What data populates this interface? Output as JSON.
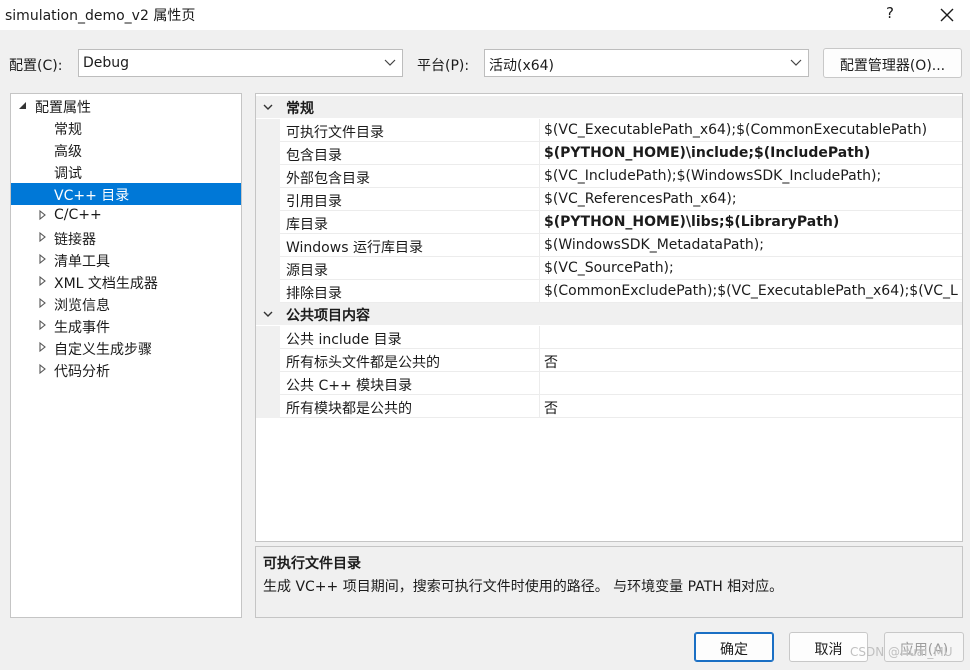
{
  "window": {
    "title": "simulation_demo_v2 属性页",
    "help_label": "?"
  },
  "toolbar": {
    "config_label": "配置(C):",
    "config_value": "Debug",
    "platform_label": "平台(P):",
    "platform_value": "活动(x64)",
    "config_manager_label": "配置管理器(O)..."
  },
  "tree": {
    "items": [
      {
        "label": "配置属性",
        "expander": "expanded"
      },
      {
        "label": "常规",
        "expander": "none"
      },
      {
        "label": "高级",
        "expander": "none"
      },
      {
        "label": "调试",
        "expander": "none"
      },
      {
        "label": "VC++ 目录",
        "expander": "none"
      },
      {
        "label": "C/C++",
        "expander": "collapsed"
      },
      {
        "label": "链接器",
        "expander": "collapsed"
      },
      {
        "label": "清单工具",
        "expander": "collapsed"
      },
      {
        "label": "XML 文档生成器",
        "expander": "collapsed"
      },
      {
        "label": "浏览信息",
        "expander": "collapsed"
      },
      {
        "label": "生成事件",
        "expander": "collapsed"
      },
      {
        "label": "自定义生成步骤",
        "expander": "collapsed"
      },
      {
        "label": "代码分析",
        "expander": "collapsed"
      }
    ],
    "selected_index": 4
  },
  "grid": {
    "categories": [
      {
        "name": "常规",
        "rows": [
          {
            "name": "可执行文件目录",
            "value": "$(VC_ExecutablePath_x64);$(CommonExecutablePath)",
            "bold": false
          },
          {
            "name": "包含目录",
            "value": "$(PYTHON_HOME)\\include;$(IncludePath)",
            "bold": true
          },
          {
            "name": "外部包含目录",
            "value": "$(VC_IncludePath);$(WindowsSDK_IncludePath);",
            "bold": false
          },
          {
            "name": "引用目录",
            "value": "$(VC_ReferencesPath_x64);",
            "bold": false
          },
          {
            "name": "库目录",
            "value": "$(PYTHON_HOME)\\libs;$(LibraryPath)",
            "bold": true
          },
          {
            "name": "Windows 运行库目录",
            "value": "$(WindowsSDK_MetadataPath);",
            "bold": false
          },
          {
            "name": "源目录",
            "value": "$(VC_SourcePath);",
            "bold": false
          },
          {
            "name": "排除目录",
            "value": "$(CommonExcludePath);$(VC_ExecutablePath_x64);$(VC_L",
            "bold": false
          }
        ]
      },
      {
        "name": "公共项目内容",
        "rows": [
          {
            "name": "公共 include 目录",
            "value": "",
            "bold": false
          },
          {
            "name": "所有标头文件都是公共的",
            "value": "否",
            "bold": false
          },
          {
            "name": "公共 C++ 模块目录",
            "value": "",
            "bold": false
          },
          {
            "name": "所有模块都是公共的",
            "value": "否",
            "bold": false
          }
        ]
      }
    ]
  },
  "description": {
    "title": "可执行文件目录",
    "text": "生成 VC++ 项目期间，搜索可执行文件时使用的路径。 与环境变量 PATH 相对应。"
  },
  "buttons": {
    "ok": "确定",
    "cancel": "取消",
    "apply": "应用(A)"
  },
  "watermark": "CSDN @Huai_MU",
  "colors": {
    "selection": "#0078d7",
    "primary_border": "#1a6fc4"
  }
}
